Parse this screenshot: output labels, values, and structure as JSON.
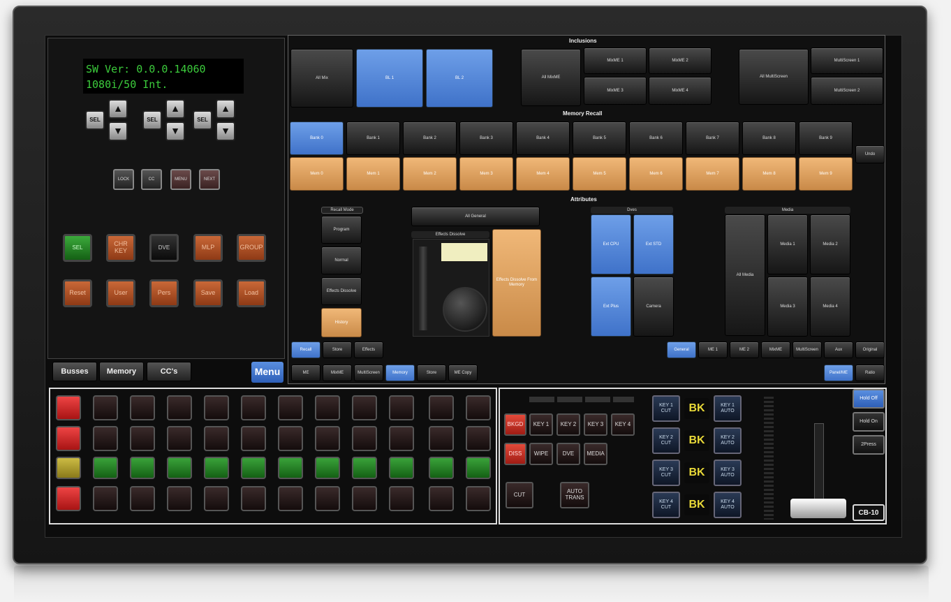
{
  "lcd": {
    "line1": "SW Ver: 0.0.0.14060",
    "line2": "1080i/50 Int."
  },
  "sel_label": "SEL",
  "arrow_up": "▲",
  "arrow_down": "▼",
  "small_buttons": [
    "LOCK",
    "CC",
    "MENU",
    "NEXT"
  ],
  "orange_row1": [
    "SEL",
    "CHR KEY",
    "DVE",
    "MLP",
    "GROUP"
  ],
  "orange_row2": [
    "Reset",
    "User",
    "Pers",
    "Save",
    "Load"
  ],
  "tabs": {
    "busses": "Busses",
    "memory": "Memory",
    "ccs": "CC's",
    "menu": "Menu"
  },
  "inclusions": {
    "title": "Inclusions",
    "all_mix": "All Mix",
    "bl1": "BL 1",
    "bl2": "BL 2",
    "all_multiviewer": "All MixME",
    "me": [
      "MixME 1",
      "MixME 2",
      "MixME 3",
      "MixME 4"
    ],
    "all_multiscreen": "All MultiScreen",
    "multiscreen": [
      "MultiScreen 1",
      "MultiScreen 2"
    ]
  },
  "memory_recall": {
    "title": "Memory Recall",
    "banks": [
      "Bank 0",
      "Bank 1",
      "Bank 2",
      "Bank 3",
      "Bank 4",
      "Bank 5",
      "Bank 6",
      "Bank 7",
      "Bank 8",
      "Bank 9"
    ],
    "mems": [
      "Mem 0",
      "Mem 1",
      "Mem 2",
      "Mem 3",
      "Mem 4",
      "Mem 5",
      "Mem 6",
      "Mem 7",
      "Mem 8",
      "Mem 9"
    ],
    "undo": "Undo"
  },
  "attributes": {
    "title": "Attributes",
    "recall_mode": "Recall Mode",
    "recall_buttons": [
      "Program",
      "Normal",
      "Effects Dissolve",
      "History"
    ],
    "all_general": "All General",
    "effects_dissolve": "Effects Dissolve",
    "effects_memory": "Effects Dissolve From Memory",
    "dves": "Dves",
    "dve_buttons": [
      "Ext CPU",
      "Ext STD",
      "Ext Plus",
      "Camera"
    ],
    "media": "Media",
    "all_media": "All Media",
    "media_buttons": [
      "Media 1",
      "Media 2",
      "Media 3",
      "Media 4"
    ]
  },
  "bottom_row1": {
    "left": [
      "Recall",
      "Store",
      "Effects"
    ],
    "right": [
      "General",
      "ME 1",
      "ME 2",
      "MixME",
      "MultiScreen",
      "Aux",
      "Original"
    ]
  },
  "bottom_row2": {
    "left": [
      "ME",
      "MixME",
      "MultiScreen",
      "Memory",
      "Store",
      "ME Copy"
    ],
    "right": [
      "Panel/ME",
      "Ratio"
    ]
  },
  "keyer": {
    "row1": [
      "KEY 1",
      "KEY 2",
      "KEY 3",
      "KEY 4"
    ],
    "row1_red": "BKGD",
    "row2": [
      "WIPE",
      "DVE",
      "MEDIA"
    ],
    "row2_red": "DISS",
    "cut": "CUT",
    "auto_trans": "AUTO TRANS"
  },
  "downstream": {
    "bk": "BK",
    "cuts": [
      "KEY 1 CUT",
      "KEY 2 CUT",
      "KEY 3 CUT",
      "KEY 4 CUT"
    ],
    "autos": [
      "KEY 1 AUTO",
      "KEY 2 AUTO",
      "KEY 3 AUTO",
      "KEY 4 AUTO"
    ]
  },
  "right_buttons": [
    "Hold Off",
    "Hold On",
    "2Press"
  ],
  "model": "CB-10"
}
